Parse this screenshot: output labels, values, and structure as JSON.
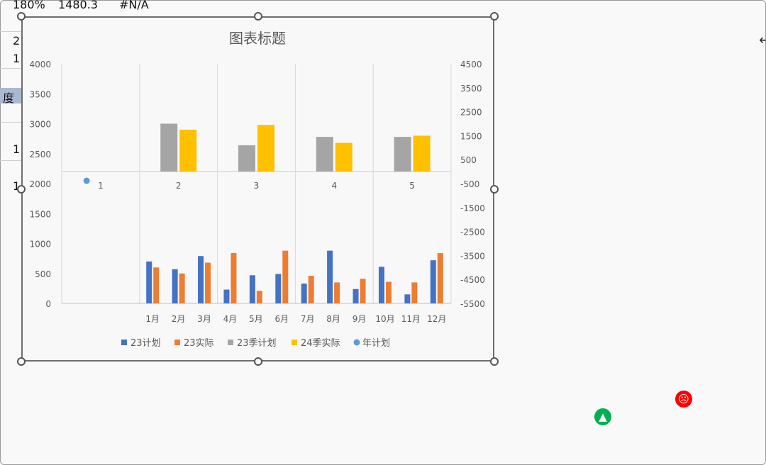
{
  "sheet": {
    "row1": [
      "180%",
      "1480.3",
      "#N/A"
    ],
    "row2": "2",
    "row3": "1",
    "row4": "度",
    "row5": "1",
    "row6": "1"
  },
  "icons": {
    "approve": "thumbs-up-icon",
    "sad": "sad-face-icon",
    "cursor": "resize-cursor-icon"
  },
  "chart_data": {
    "type": "bar",
    "title": "图表标题",
    "legend_placement": "bottom",
    "legend": [
      "23计划",
      "23实际",
      "23季计划",
      "24季实际",
      "年计划"
    ],
    "colors": {
      "23计划": "#4472c4",
      "23实际": "#ed7d31",
      "23季计划": "#a5a5a5",
      "24季实际": "#ffc000",
      "年计划": "#5b9bd5"
    },
    "primary_axis": {
      "ticks": [
        "4000",
        "3500",
        "3000",
        "2500",
        "2000",
        "1500",
        "1000",
        "500",
        "0"
      ],
      "ylim": [
        0,
        4000
      ]
    },
    "secondary_axis": {
      "ticks": [
        "4500",
        "3500",
        "2500",
        "1500",
        "500",
        "-500",
        "-1500",
        "-2500",
        "-3500",
        "-4500",
        "-5500"
      ],
      "ylim": [
        -5500,
        4500
      ]
    },
    "month_categories": [
      "1月",
      "2月",
      "3月",
      "4月",
      "5月",
      "6月",
      "7月",
      "8月",
      "9月",
      "10月",
      "11月",
      "12月"
    ],
    "quarter_categories": [
      "1",
      "2",
      "3",
      "4",
      "5"
    ],
    "monthly_series": [
      {
        "name": "23计划",
        "values": [
          700,
          570,
          790,
          230,
          470,
          490,
          330,
          880,
          240,
          610,
          150,
          720
        ]
      },
      {
        "name": "23实际",
        "values": [
          600,
          500,
          680,
          840,
          210,
          880,
          460,
          350,
          410,
          360,
          350,
          840
        ]
      }
    ],
    "quarterly_series": [
      {
        "name": "23季计划",
        "values": [
          null,
          2000,
          1100,
          1450,
          1450
        ]
      },
      {
        "name": "24季实际",
        "values": [
          null,
          1750,
          1950,
          1200,
          1500
        ]
      }
    ],
    "annual_series": {
      "name": "年计划",
      "x": "1",
      "value": 2040
    },
    "grid": true
  }
}
